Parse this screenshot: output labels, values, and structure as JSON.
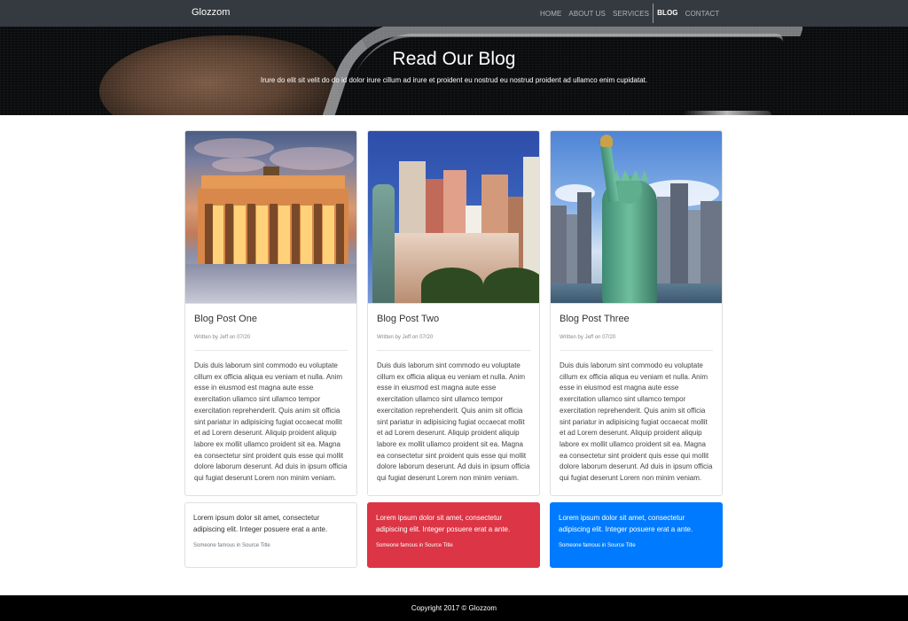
{
  "navbar": {
    "brand": "Glozzom",
    "items": [
      {
        "label": "HOME",
        "active": false
      },
      {
        "label": "ABOUT US",
        "active": false
      },
      {
        "label": "SERVICES",
        "active": false
      },
      {
        "label": "BLOG",
        "active": true
      },
      {
        "label": "CONTACT",
        "active": false
      }
    ]
  },
  "hero": {
    "title": "Read Our Blog",
    "subtitle": "Irure do elit sit velit do do id dolor irure cillum ad irure et proident eu nostrud eu nostrud proident ad ullamco enim cupidatat."
  },
  "posts": [
    {
      "title": "Blog Post One",
      "meta": "Written by Jeff on 07/20",
      "body": "Duis duis laborum sint commodo eu voluptate cillum ex officia aliqua eu veniam et nulla. Anim esse in eiusmod est magna aute esse exercitation ullamco sint ullamco tempor exercitation reprehenderit. Quis anim sit officia sint pariatur in adipisicing fugiat occaecat mollit et ad Lorem deserunt. Aliquip proident aliquip labore ex mollit ullamco proident sit ea. Magna ea consectetur sint proident quis esse qui mollit dolore laborum deserunt. Ad duis in ipsum officia qui fugiat deserunt Lorem non minim veniam.",
      "image_icon": "brandenburg-gate-photo"
    },
    {
      "title": "Blog Post Two",
      "meta": "Written by Jeff on 07/20",
      "body": "Duis duis laborum sint commodo eu voluptate cillum ex officia aliqua eu veniam et nulla. Anim esse in eiusmod est magna aute esse exercitation ullamco sint ullamco tempor exercitation reprehenderit. Quis anim sit officia sint pariatur in adipisicing fugiat occaecat mollit et ad Lorem deserunt. Aliquip proident aliquip labore ex mollit ullamco proident sit ea. Magna ea consectetur sint proident quis esse qui mollit dolore laborum deserunt. Ad duis in ipsum officia qui fugiat deserunt Lorem non minim veniam.",
      "image_icon": "city-skyline-photo"
    },
    {
      "title": "Blog Post Three",
      "meta": "Written by Jeff on 07/20",
      "body": "Duis duis laborum sint commodo eu voluptate cillum ex officia aliqua eu veniam et nulla. Anim esse in eiusmod est magna aute esse exercitation ullamco sint ullamco tempor exercitation reprehenderit. Quis anim sit officia sint pariatur in adipisicing fugiat occaecat mollit et ad Lorem deserunt. Aliquip proident aliquip labore ex mollit ullamco proident sit ea. Magna ea consectetur sint proident quis esse qui mollit dolore laborum deserunt. Ad duis in ipsum officia qui fugiat deserunt Lorem non minim veniam.",
      "image_icon": "statue-of-liberty-photo"
    }
  ],
  "quotes": [
    {
      "text": "Lorem ipsum dolor sit amet, consectetur adipiscing elit. Integer posuere erat a ante.",
      "source": "Someone famous in Source Title",
      "variant": "white"
    },
    {
      "text": "Lorem ipsum dolor sit amet, consectetur adipiscing elit. Integer posuere erat a ante.",
      "source": "Someone famous in Source Title",
      "variant": "#dc3545"
    },
    {
      "text": "Lorem ipsum dolor sit amet, consectetur adipiscing elit. Integer posuere erat a ante.",
      "source": "Someone famous in Source Title",
      "variant": "#007bff"
    }
  ],
  "footer": {
    "copyright": "Copyright 2017 © Glozzom"
  },
  "colors": {
    "navbar": "#343a40",
    "danger": "#dc3545",
    "primary": "#007bff",
    "footer": "#000000"
  }
}
